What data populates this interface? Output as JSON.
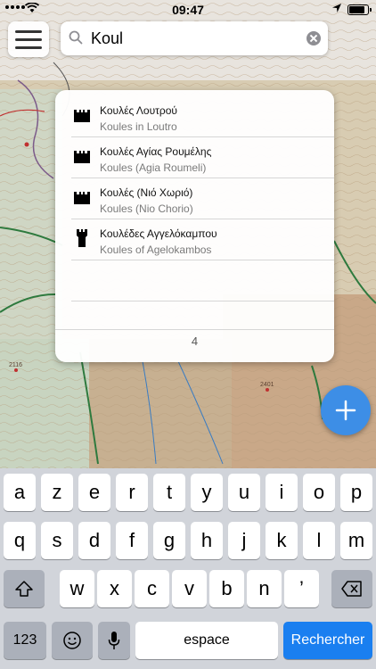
{
  "status_bar": {
    "time": "09:47"
  },
  "search": {
    "query": "Koul"
  },
  "results": {
    "items": [
      {
        "title": "Κουλές Λουτρού",
        "subtitle": "Koules in Loutro",
        "icon": "castle-icon"
      },
      {
        "title": "Κουλές Αγίας Ρουμέλης",
        "subtitle": "Koules (Agia Roumeli)",
        "icon": "castle-icon"
      },
      {
        "title": "Κουλές (Νιό Χωριό)",
        "subtitle": "Koules (Nio Chorio)",
        "icon": "castle-icon"
      },
      {
        "title": "Κουλέδες Αγγελόκαμπου",
        "subtitle": "Koules of Agelokambos",
        "icon": "tower-icon"
      }
    ],
    "count": "4"
  },
  "map": {
    "elevations": [
      "2116",
      "2401"
    ]
  },
  "keyboard": {
    "row1": [
      "a",
      "z",
      "e",
      "r",
      "t",
      "y",
      "u",
      "i",
      "o",
      "p"
    ],
    "row2": [
      "q",
      "s",
      "d",
      "f",
      "g",
      "h",
      "j",
      "k",
      "l",
      "m"
    ],
    "row3": [
      "w",
      "x",
      "c",
      "v",
      "b",
      "n",
      "’"
    ],
    "numbers_label": "123",
    "space_label": "espace",
    "return_label": "Rechercher"
  },
  "colors": {
    "accent": "#3d8ee6",
    "return_key": "#1a7ff0"
  }
}
